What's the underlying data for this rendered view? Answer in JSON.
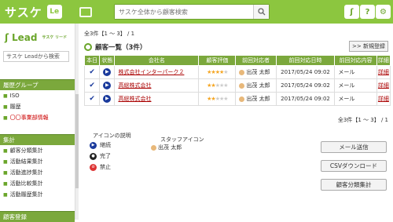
{
  "header": {
    "logo": "サスケ",
    "badge": "Le",
    "search_placeholder": "サスケ全体から顧客検索",
    "help": "?"
  },
  "sidebar": {
    "title": "Lead",
    "title_sub": "サスケ リード",
    "search_placeholder": "サスケ Leadから検索",
    "group_title": "履歴グループ",
    "group_items": [
      "ISO",
      "履歴",
      "〇〇事業部情報"
    ],
    "stats_title": "集計",
    "stats_items": [
      "顧客分類集計",
      "活動結果集計",
      "活動進捗集計",
      "活動比較集計",
      "活動履歴集計"
    ],
    "reg_title": "顧客登録"
  },
  "main": {
    "count_top": "全3件【1 ～ 3】 / 1",
    "list_title": "顧客一覧（3件）",
    "new_button": ">> 新規登録",
    "columns": [
      "本日",
      "状態",
      "会社名",
      "顧客評価",
      "前回対応者",
      "前回対応日時",
      "前回対応内容",
      "詳細"
    ],
    "rows": [
      {
        "company": "株式会社インターパーク２",
        "stars": 4,
        "contact": "出茂 太郎",
        "date": "2017/05/24 09:02",
        "content": "メール",
        "detail": "詳細"
      },
      {
        "company": "高総株式会社",
        "stars": 2,
        "contact": "出茂 太郎",
        "date": "2017/05/24 09:02",
        "content": "メール",
        "detail": "詳細"
      },
      {
        "company": "高総株式会社",
        "stars": 2,
        "contact": "出茂 太郎",
        "date": "2017/05/24 09:02",
        "content": "メール",
        "detail": "詳細"
      }
    ],
    "count_bottom": "全3件【1 ～ 3】 / 1",
    "legend_title": "アイコンの説明",
    "legend": [
      "継続",
      "完了",
      "禁止"
    ],
    "staff_title": "スタッフアイコン",
    "staff_name": "出茂 太郎",
    "buttons": [
      "メール送信",
      "CSVダウンロード",
      "顧客分類集計"
    ]
  }
}
